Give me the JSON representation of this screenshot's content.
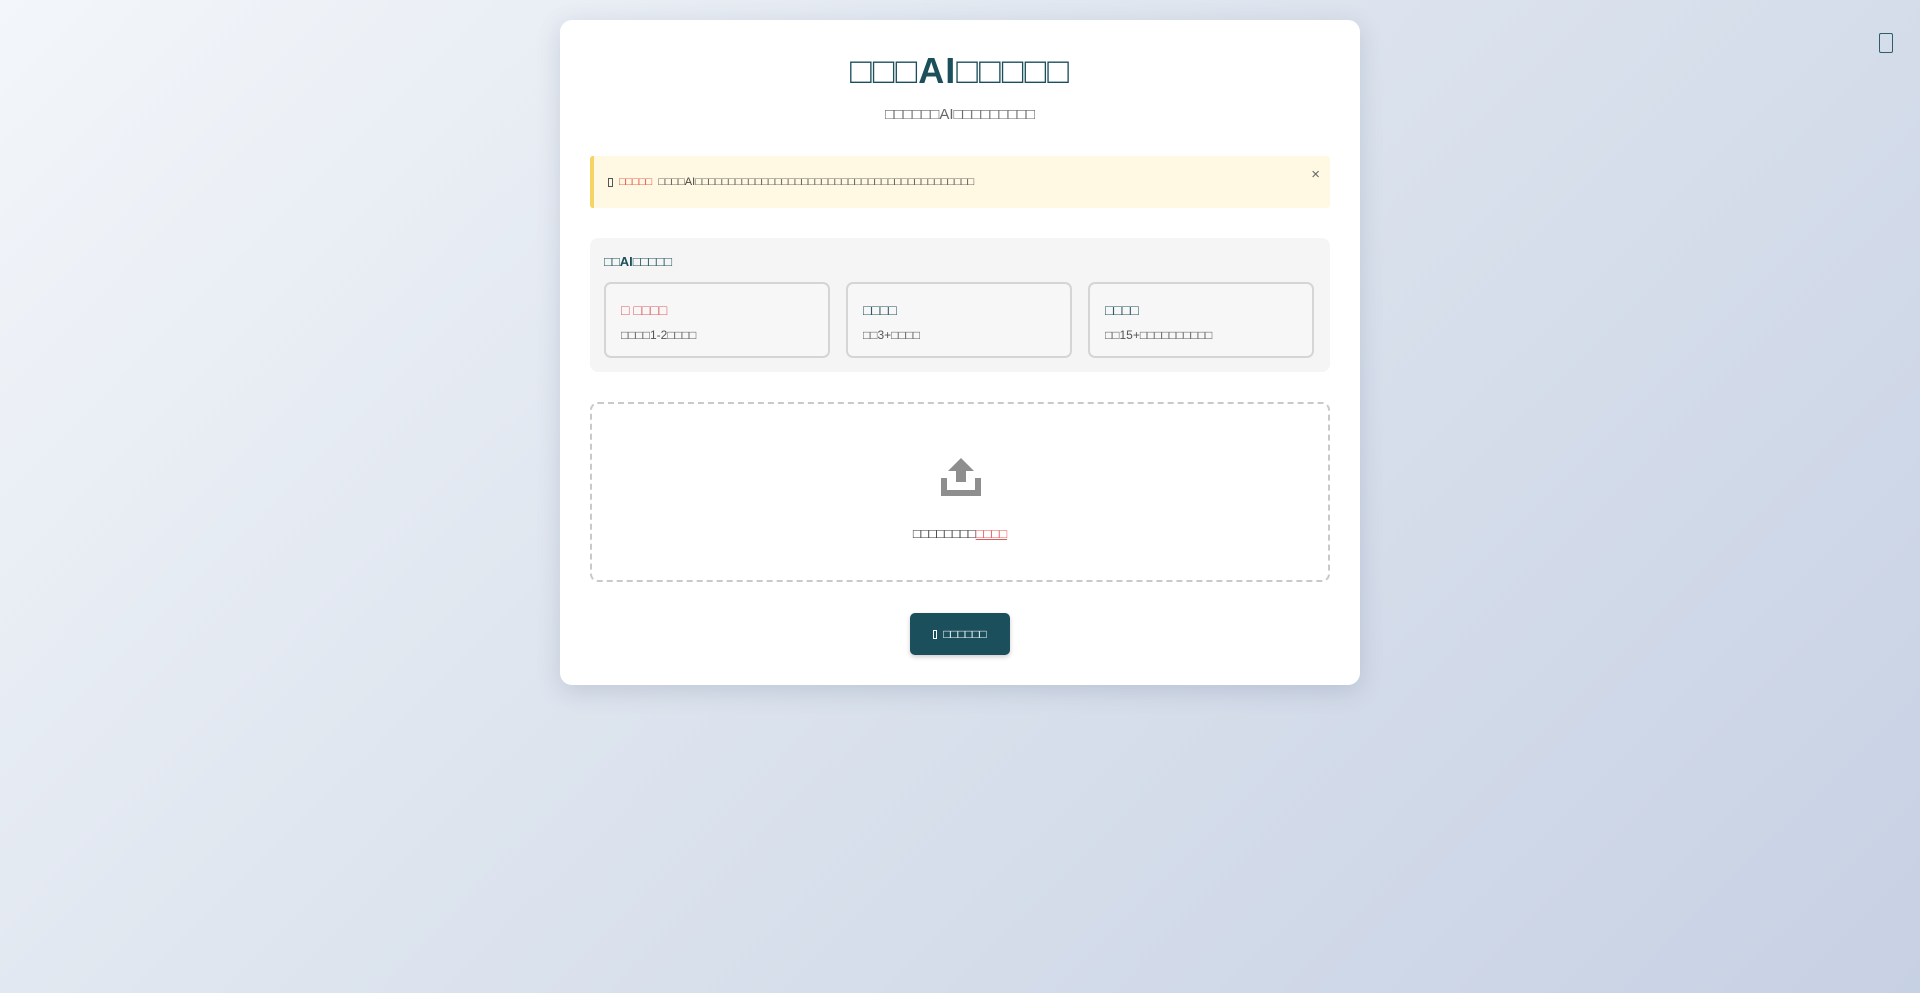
{
  "header": {
    "title": "□□□AI□□□□□",
    "subtitle": "□□□□□□AI□□□□□□□□□"
  },
  "notice": {
    "highlight": "□□□□□",
    "text": "□□□□AI□□□□□□□□□□□□□□□□□□□□□□□□□□□□□□□□□□□□□□□□□□",
    "close_label": "×"
  },
  "models": {
    "heading": "□□AI□□□□□",
    "items": [
      {
        "name": "□ □□□□",
        "desc": "□□□□1-2□□□□"
      },
      {
        "name": "□□□□",
        "desc": "□□3+□□□□"
      },
      {
        "name": "□□□□",
        "desc": "□□15+□□□□□□□□□□"
      }
    ]
  },
  "upload": {
    "hint": "□□□□□□□□",
    "link": "□□□□"
  },
  "convert_button": {
    "label": "□□□□□□"
  },
  "colors": {
    "primary": "#1b4f5b",
    "accent": "#e05a5a",
    "notice_bg": "#fff8e3",
    "notice_border": "#f6d365"
  },
  "icons": {
    "upload": "upload-tray-icon",
    "corner": "menu-icon"
  }
}
